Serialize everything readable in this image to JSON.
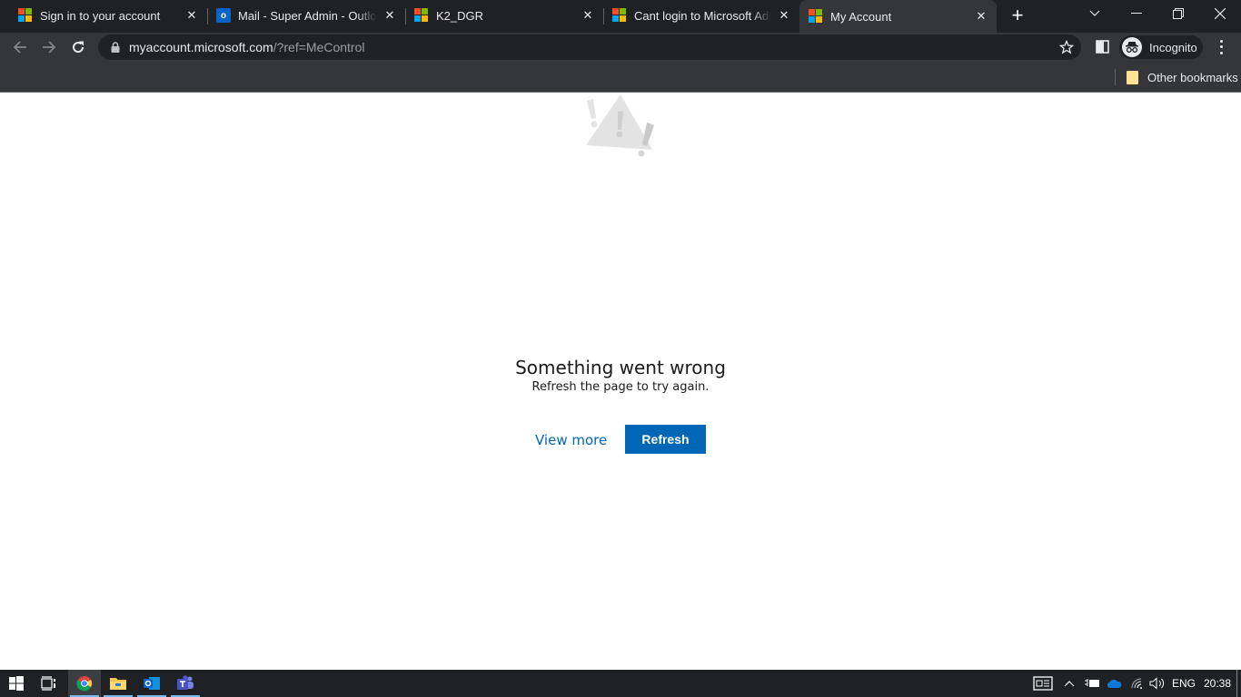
{
  "browser": {
    "tabs": [
      {
        "title": "Sign in to your account",
        "favicon": "microsoft-logo",
        "active": false
      },
      {
        "title": "Mail - Super Admin - Outlook",
        "favicon": "outlook-icon",
        "active": false
      },
      {
        "title": "K2_DGR",
        "favicon": "microsoft-logo",
        "active": false
      },
      {
        "title": "Cant login to Microsoft Admin",
        "favicon": "microsoft-logo",
        "active": false
      },
      {
        "title": "My Account",
        "favicon": "microsoft-logo",
        "active": true
      }
    ],
    "new_tab_label": "+",
    "address": {
      "domain": "myaccount.microsoft.com",
      "path": "/?ref=MeControl"
    },
    "profile_label": "Incognito",
    "bookmarks": {
      "other_label": "Other bookmarks"
    }
  },
  "page": {
    "error_title": "Something went wrong",
    "error_subtitle": "Refresh the page to try again.",
    "view_more_label": "View more",
    "refresh_label": "Refresh",
    "accent_color": "#0067b8"
  },
  "taskbar": {
    "apps": [
      "start",
      "task-view",
      "chrome",
      "file-explorer",
      "outlook",
      "teams"
    ],
    "language": "ENG",
    "time": "20:38"
  }
}
